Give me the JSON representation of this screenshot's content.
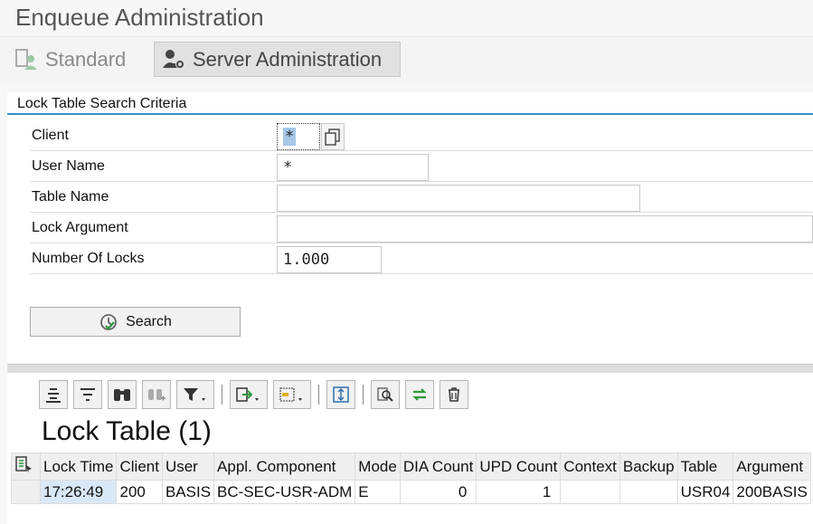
{
  "app": {
    "title": "Enqueue Administration"
  },
  "tabs": [
    {
      "label": "Standard",
      "icon": "user-screen-icon",
      "active": false
    },
    {
      "label": "Server Administration",
      "icon": "server-admin-icon",
      "active": true
    }
  ],
  "criteria": {
    "header": "Lock Table Search Criteria",
    "fields": [
      {
        "label": "Client",
        "value": "*"
      },
      {
        "label": "User Name",
        "value": "*"
      },
      {
        "label": "Table Name",
        "value": ""
      },
      {
        "label": "Lock Argument",
        "value": ""
      },
      {
        "label": "Number Of Locks",
        "value": "1.000"
      }
    ],
    "search_label": "Search"
  },
  "lock_table": {
    "title": "Lock Table (1)",
    "toolbar_icons": [
      "align-center-icon",
      "align-list-icon",
      "binoculars-icon",
      "find-next-icon",
      "filter-icon",
      "export-icon",
      "layout-icon",
      "expand-icon",
      "zoom-icon",
      "refresh-icon",
      "delete-icon"
    ],
    "columns": [
      "Lock Time",
      "Client",
      "User",
      "Appl. Component",
      "Mode",
      "DIA Count",
      "UPD Count",
      "Context",
      "Backup",
      "Table",
      "Argument"
    ],
    "rows": [
      [
        "17:26:49",
        "200",
        "BASIS",
        "BC-SEC-USR-ADM",
        "E",
        "0",
        "1",
        "",
        "",
        "USR04",
        "200BASIS"
      ]
    ]
  },
  "colors": {
    "accent": "#3b8fc4",
    "selected_cell": "#d8e8f7",
    "field_highlight": "#a7c6e8"
  }
}
